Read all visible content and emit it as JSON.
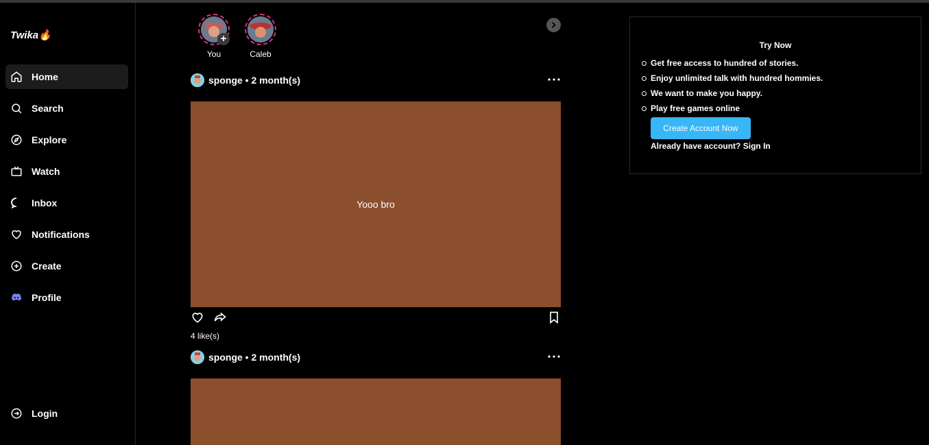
{
  "app": {
    "logo": "Twika🔥"
  },
  "sidebar": {
    "items": [
      {
        "label": "Home",
        "icon": "home-icon"
      },
      {
        "label": "Search",
        "icon": "search-icon"
      },
      {
        "label": "Explore",
        "icon": "compass-icon"
      },
      {
        "label": "Watch",
        "icon": "tv-icon"
      },
      {
        "label": "Inbox",
        "icon": "chat-bubble-icon"
      },
      {
        "label": "Notifications",
        "icon": "heart-icon"
      },
      {
        "label": "Create",
        "icon": "plus-circle-icon"
      },
      {
        "label": "Profile",
        "icon": "discord-icon"
      }
    ],
    "login": "Login"
  },
  "stories": [
    {
      "name": "You"
    },
    {
      "name": "Caleb"
    }
  ],
  "posts": [
    {
      "header": "sponge • 2 month(s)",
      "content": "Yooo bro",
      "likes": "4 like(s)"
    },
    {
      "header": "sponge • 2 month(s)",
      "content": ""
    }
  ],
  "panel": {
    "title": "Try Now",
    "features": [
      "Get free access to hundred of stories.",
      "Enjoy unlimited talk with hundred hommies.",
      "We want to make you happy.",
      "Play free games online"
    ],
    "cta": "Create Account Now",
    "signin_prefix": "Already have account?",
    "signin_link": "Sign In"
  },
  "colors": {
    "accent": "#38b6f5",
    "post_bg": "#8b4f2d",
    "story_ring": "#d63384"
  }
}
